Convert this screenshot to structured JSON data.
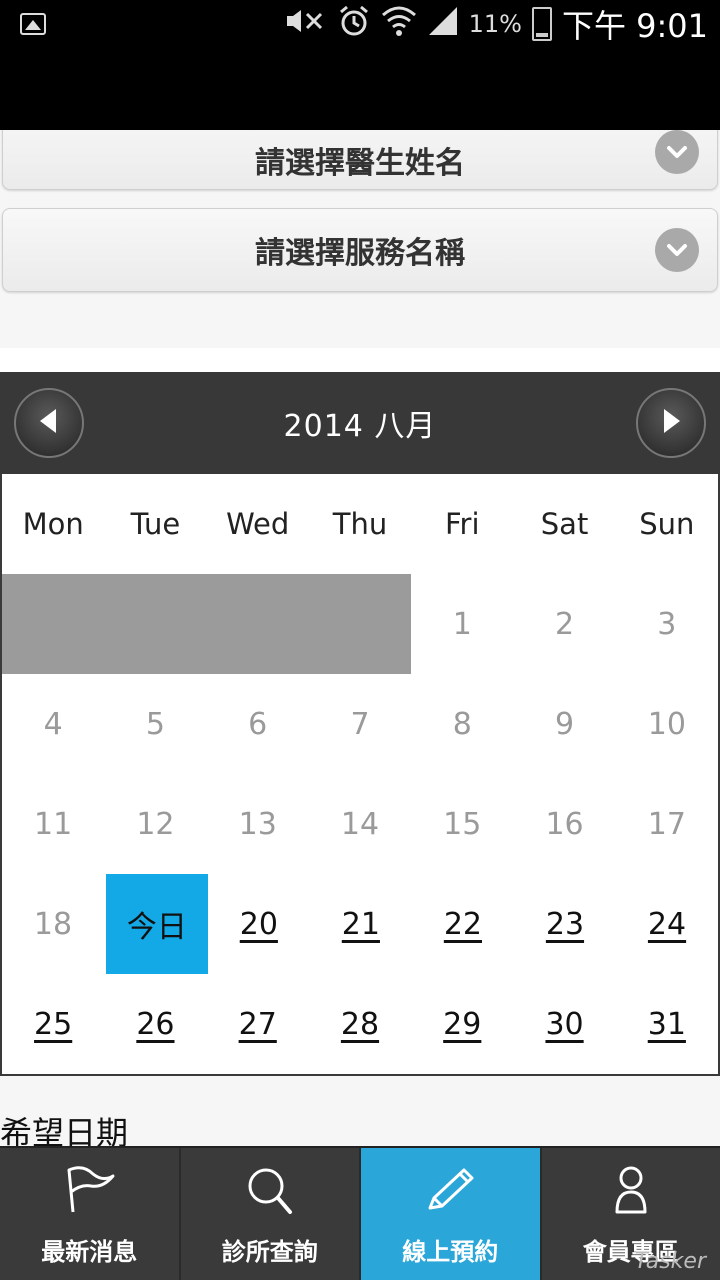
{
  "status_bar": {
    "battery_percent": "11%",
    "time": "下午 9:01",
    "icons": [
      "image-icon",
      "mute-icon",
      "alarm-icon",
      "wifi-icon",
      "signal-icon",
      "battery-icon"
    ]
  },
  "selects": {
    "doctor": {
      "placeholder": "請選擇醫生姓名"
    },
    "service": {
      "placeholder": "請選擇服務名稱"
    }
  },
  "calendar": {
    "title": "2014  八月",
    "weekdays": [
      "Mon",
      "Tue",
      "Wed",
      "Thu",
      "Fri",
      "Sat",
      "Sun"
    ],
    "weeks": [
      [
        "",
        "",
        "",
        "",
        "1",
        "2",
        "3"
      ],
      [
        "4",
        "5",
        "6",
        "7",
        "8",
        "9",
        "10"
      ],
      [
        "11",
        "12",
        "13",
        "14",
        "15",
        "16",
        "17"
      ],
      [
        "18",
        "今日",
        "20",
        "21",
        "22",
        "23",
        "24"
      ],
      [
        "25",
        "26",
        "27",
        "28",
        "29",
        "30",
        "31"
      ]
    ],
    "today_label": "今日",
    "colors": {
      "today": "#13a8e6",
      "header": "#383838",
      "blank": "#9b9b9b"
    }
  },
  "wish_date_label": "希望日期",
  "bottom_nav": {
    "tabs": [
      {
        "label": "最新消息",
        "icon": "flag-icon",
        "active": false
      },
      {
        "label": "診所查詢",
        "icon": "search-icon",
        "active": false
      },
      {
        "label": "線上預約",
        "icon": "pencil-icon",
        "active": true
      },
      {
        "label": "會員專區",
        "icon": "user-icon",
        "active": false
      }
    ],
    "active_color": "#2aa6d8"
  },
  "watermark": "Tasker"
}
